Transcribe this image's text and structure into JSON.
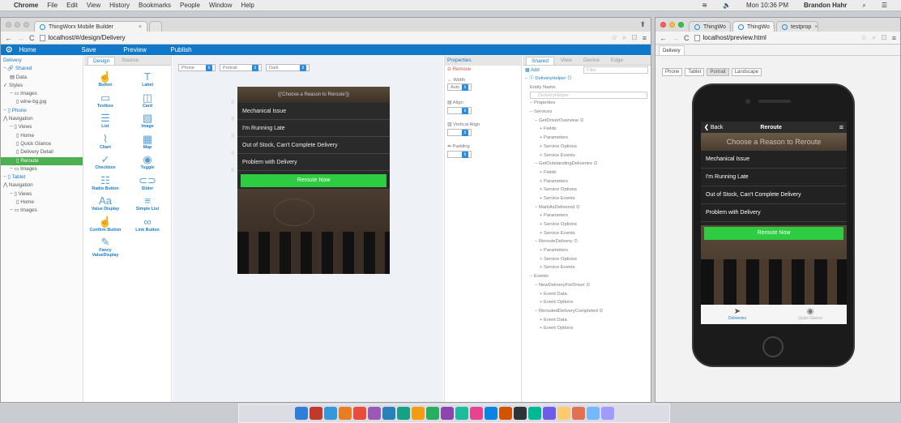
{
  "menubar": {
    "app": "Chrome",
    "items": [
      "File",
      "Edit",
      "View",
      "History",
      "Bookmarks",
      "People",
      "Window",
      "Help"
    ],
    "clock": "Mon 10:36 PM",
    "user": "Brandon Hahr"
  },
  "left_window": {
    "tab_title": "ThingWorx Mobile Builder",
    "url": "localhost/#/design/Delivery",
    "appbar": {
      "home": "Home",
      "save": "Save",
      "preview": "Preview",
      "publish": "Publish"
    },
    "tree": [
      {
        "label": "Delivery",
        "indent": 0,
        "blue": true
      },
      {
        "label": "− 🔗 Shared",
        "indent": 0,
        "blue": true
      },
      {
        "label": "▤ Data",
        "indent": 1
      },
      {
        "label": "✓ Styles",
        "indent": 0
      },
      {
        "label": "− ▭ Images",
        "indent": 1
      },
      {
        "label": "▯ wine-bg.jpg",
        "indent": 2
      },
      {
        "label": "− ▯ Phone",
        "indent": 0,
        "blue": true
      },
      {
        "label": "⋀ Navigation",
        "indent": 0
      },
      {
        "label": "− ▯ Views",
        "indent": 1
      },
      {
        "label": "▯ Home",
        "indent": 2
      },
      {
        "label": "▯ Quick Glance",
        "indent": 2
      },
      {
        "label": "▯ Delivery Detail",
        "indent": 2
      },
      {
        "label": "▯ Reroute",
        "indent": 2,
        "selected": true
      },
      {
        "label": "− ▭ Images",
        "indent": 1
      },
      {
        "label": "− ▯ Tablet",
        "indent": 0,
        "blue": true
      },
      {
        "label": "⋀ Navigation",
        "indent": 0
      },
      {
        "label": "− ▯ Views",
        "indent": 1
      },
      {
        "label": "▯ Home",
        "indent": 2
      },
      {
        "label": "− ▭ Images",
        "indent": 1
      }
    ],
    "subtabs": {
      "design": "Design",
      "source": "Source"
    },
    "widgets": [
      {
        "label": "Button",
        "icon": "☝"
      },
      {
        "label": "Label",
        "icon": "T"
      },
      {
        "label": "Textbox",
        "icon": "▭"
      },
      {
        "label": "Card",
        "icon": "◫"
      },
      {
        "label": "List",
        "icon": "☰"
      },
      {
        "label": "Image",
        "icon": "▧"
      },
      {
        "label": "Chart",
        "icon": "⌇"
      },
      {
        "label": "Map",
        "icon": "▦"
      },
      {
        "label": "Checkbox",
        "icon": "✓"
      },
      {
        "label": "Toggle",
        "icon": "◉"
      },
      {
        "label": "Radio Button",
        "icon": "☷"
      },
      {
        "label": "Slider",
        "icon": "⊂⊃"
      },
      {
        "label": "Value Display",
        "icon": "Aa"
      },
      {
        "label": "Simple List",
        "icon": "≡"
      },
      {
        "label": "Confirm Button",
        "icon": "☝"
      },
      {
        "label": "Link Button",
        "icon": "∞"
      },
      {
        "label": "Fancy ValueDisplay",
        "icon": "✎"
      }
    ],
    "toolbar": {
      "device": "Phone",
      "orientation": "Portrait",
      "theme": "Dark"
    },
    "canvas": {
      "header": "{{'Choose a Reason to Reroute'}}",
      "items": [
        "Mechanical Issue",
        "I'm Running Late",
        "Out of Stock, Can't Complete Delivery",
        "Problem with Delivery"
      ],
      "button": "Reroute Now"
    },
    "properties": {
      "title": "Properties",
      "remove": "Remove",
      "width": "Width",
      "width_value": "Auto",
      "align": "Align",
      "valign": "Vertical Align",
      "padding": "Padding"
    },
    "data_panel": {
      "tabs": [
        "Shared",
        "View",
        "Device",
        "Edge"
      ],
      "add": "Add",
      "filter": "Filter",
      "entity_label": "Entity Name",
      "entity_value": "DeliveryHelper",
      "lines": [
        {
          "text": "− ⓢ DeliveryHelper ⊙",
          "indent": 0,
          "blue": true
        },
        {
          "text": "Entity Name",
          "indent": 1
        },
        {
          "text": "",
          "indent": 1
        },
        {
          "text": "− Properties",
          "indent": 1
        },
        {
          "text": "− Services",
          "indent": 1
        },
        {
          "text": "− GetDriverOverview ⊙",
          "indent": 2
        },
        {
          "text": "+ Fields",
          "indent": 3
        },
        {
          "text": "+ Parameters",
          "indent": 3
        },
        {
          "text": "+ Service Options",
          "indent": 3
        },
        {
          "text": "+ Service Events",
          "indent": 3
        },
        {
          "text": "− GetOutstandingDeliveries ⊙",
          "indent": 2
        },
        {
          "text": "+ Fields",
          "indent": 3
        },
        {
          "text": "+ Parameters",
          "indent": 3
        },
        {
          "text": "+ Service Options",
          "indent": 3
        },
        {
          "text": "+ Service Events",
          "indent": 3
        },
        {
          "text": "− MarkAsDelivered ⊙",
          "indent": 2
        },
        {
          "text": "+ Parameters",
          "indent": 3
        },
        {
          "text": "+ Service Options",
          "indent": 3
        },
        {
          "text": "+ Service Events",
          "indent": 3
        },
        {
          "text": "− RerouteDelivery ⊙",
          "indent": 2
        },
        {
          "text": "+ Parameters",
          "indent": 3
        },
        {
          "text": "+ Service Options",
          "indent": 3
        },
        {
          "text": "+ Service Events",
          "indent": 3
        },
        {
          "text": "− Events",
          "indent": 1
        },
        {
          "text": "− NewDeliveryForDriver ⊙",
          "indent": 2
        },
        {
          "text": "+ Event Data",
          "indent": 3
        },
        {
          "text": "+ Event Options",
          "indent": 3
        },
        {
          "text": "− ReroutedDeliveryCompleted ⊙",
          "indent": 2
        },
        {
          "text": "+ Event Data",
          "indent": 3
        },
        {
          "text": "+ Event Options",
          "indent": 3
        }
      ]
    }
  },
  "right_window": {
    "tabs": [
      "ThingWo",
      "ThingWo",
      "testprop"
    ],
    "url": "localhost/preview.html",
    "page_tab": "Delivery",
    "devices": [
      "Phone",
      "Tablet",
      "Portrait",
      "Landscape"
    ],
    "nav": {
      "back": "Back",
      "title": "Reroute"
    },
    "header": "Choose a Reason to Reroute",
    "items": [
      "Mechanical Issue",
      "I'm Running Late",
      "Out of Stock, Can't Complete Delivery",
      "Problem with Delivery"
    ],
    "button": "Reroute Now",
    "bottom_tabs": [
      {
        "label": "Deliveries"
      },
      {
        "label": "Quick Glance"
      }
    ]
  },
  "colors": {
    "accent": "#1178c9",
    "selected": "#4caf50",
    "go": "#2ecc40"
  }
}
